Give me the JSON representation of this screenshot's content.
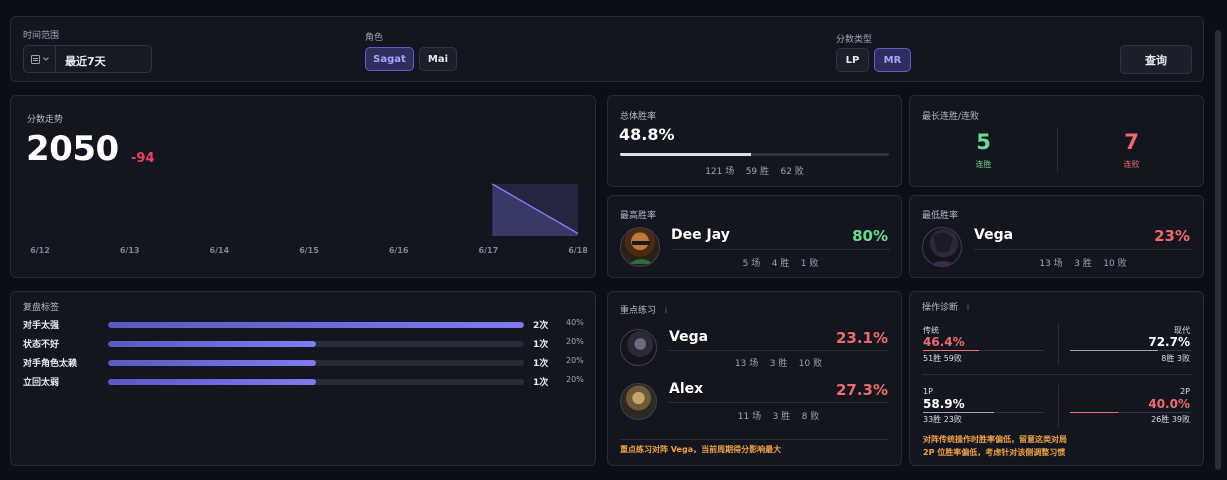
{
  "filters": {
    "time_label": "时间范围",
    "time_value": "最近7天",
    "char_label": "角色",
    "chars": [
      "Sagat",
      "Mai"
    ],
    "score_label": "分数类型",
    "score_types": [
      "LP",
      "MR"
    ],
    "query": "查询"
  },
  "trend": {
    "title": "分数走势",
    "score": "2050",
    "delta": "-94",
    "chart_data": {
      "type": "area",
      "x": [
        "6/12",
        "6/13",
        "6/14",
        "6/15",
        "6/16",
        "6/17",
        "6/18"
      ],
      "series": [
        {
          "values": [
            null,
            null,
            null,
            null,
            null,
            2144,
            2050
          ]
        }
      ],
      "title": "",
      "xlabel": "",
      "ylabel": "",
      "grid": false
    }
  },
  "winrate": {
    "title": "总体胜率",
    "value": "48.8%",
    "fraction": 0.488,
    "games": "121 场",
    "wins": "59 胜",
    "losses": "62 败"
  },
  "streak": {
    "title": "最长连胜/连败",
    "win_value": "5",
    "win_label": "连胜",
    "loss_value": "7",
    "loss_label": "连败"
  },
  "best": {
    "title": "最高胜率",
    "name": "Dee Jay",
    "rate": "80%",
    "games": "5 场",
    "wins": "4 胜",
    "losses": "1 败"
  },
  "worst": {
    "title": "最低胜率",
    "name": "Vega",
    "rate": "23%",
    "games": "13 场",
    "wins": "3 胜",
    "losses": "10 败"
  },
  "tags": {
    "title": "复盘标签",
    "items": [
      {
        "label": "对手太强",
        "count": "2次",
        "pct": "40%",
        "fraction": 1.0
      },
      {
        "label": "状态不好",
        "count": "1次",
        "pct": "20%",
        "fraction": 0.5
      },
      {
        "label": "对手角色太赖",
        "count": "1次",
        "pct": "20%",
        "fraction": 0.5
      },
      {
        "label": "立回太弱",
        "count": "1次",
        "pct": "20%",
        "fraction": 0.5
      }
    ]
  },
  "practice": {
    "title": "重点练习",
    "info": "i",
    "items": [
      {
        "name": "Vega",
        "rate": "23.1%",
        "games": "13 场",
        "wins": "3 胜",
        "losses": "10 败"
      },
      {
        "name": "Alex",
        "rate": "27.3%",
        "games": "11 场",
        "wins": "3 胜",
        "losses": "8 败"
      }
    ],
    "note": "重点练习对阵 Vega，当前周期得分影响最大"
  },
  "diag": {
    "title": "操作诊断",
    "info": "i",
    "classic": {
      "label": "传统",
      "value": "46.4%",
      "record": "51胜 59败",
      "fraction": 0.464
    },
    "modern": {
      "label": "现代",
      "value": "72.7%",
      "record": "8胜 3败",
      "fraction": 0.727
    },
    "p1": {
      "label": "1P",
      "value": "58.9%",
      "record": "33胜 23败",
      "fraction": 0.589
    },
    "p2": {
      "label": "2P",
      "value": "40.0%",
      "record": "26胜 39败",
      "fraction": 0.4
    },
    "note1": "对阵传统操作时胜率偏低，留意这类对局",
    "note2": "2P 位胜率偏低，考虑针对该侧调整习惯"
  }
}
